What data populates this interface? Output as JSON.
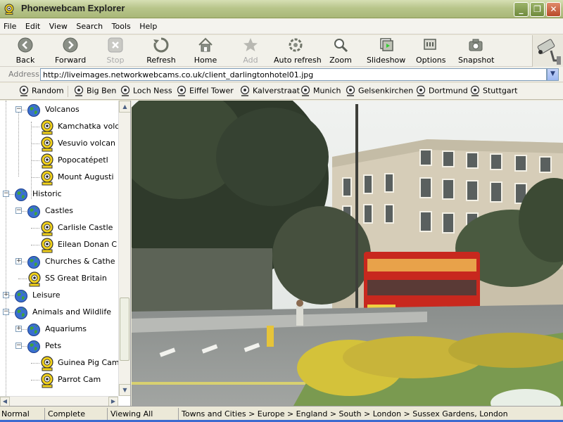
{
  "window": {
    "title": "Phonewebcam Explorer"
  },
  "menu": [
    "File",
    "Edit",
    "View",
    "Search",
    "Tools",
    "Help"
  ],
  "toolbar": [
    {
      "label": "Back",
      "icon": "back-arrow-icon",
      "enabled": true
    },
    {
      "label": "Forward",
      "icon": "forward-arrow-icon",
      "enabled": true
    },
    {
      "label": "Stop",
      "icon": "stop-icon",
      "enabled": false
    },
    {
      "label": "Refresh",
      "icon": "refresh-icon",
      "enabled": true
    },
    {
      "label": "Home",
      "icon": "home-icon",
      "enabled": true
    },
    {
      "label": "Add",
      "icon": "star-icon",
      "enabled": false
    },
    {
      "label": "Auto refresh",
      "icon": "auto-refresh-icon",
      "enabled": true
    },
    {
      "label": "Zoom",
      "icon": "magnifier-icon",
      "enabled": true
    },
    {
      "label": "Slideshow",
      "icon": "slideshow-icon",
      "enabled": true
    },
    {
      "label": "Options",
      "icon": "options-icon",
      "enabled": true
    },
    {
      "label": "Snapshot",
      "icon": "camera-icon",
      "enabled": true
    }
  ],
  "address": {
    "label": "Address",
    "value": "http://liveimages.networkwebcams.co.uk/client_darlingtonhotel01.jpg"
  },
  "links": [
    "Random",
    "Big Ben",
    "Loch Ness",
    "Eiffel Tower",
    "Kalverstraat",
    "Munich",
    "Gelsenkirchen",
    "Dortmund",
    "Stuttgart"
  ],
  "tree": {
    "nodes": [
      {
        "label": "Volcanos",
        "type": "globe",
        "expander": "−"
      },
      {
        "label": "Kamchatka volc",
        "type": "cam"
      },
      {
        "label": "Vesuvio volcan",
        "type": "cam"
      },
      {
        "label": "Popocatépetl",
        "type": "cam"
      },
      {
        "label": "Mount Augusti",
        "type": "cam"
      },
      {
        "label": "Historic",
        "type": "globe",
        "expander": "−"
      },
      {
        "label": "Castles",
        "type": "globe",
        "expander": "−"
      },
      {
        "label": "Carlisle Castle",
        "type": "cam"
      },
      {
        "label": "Eilean Donan C",
        "type": "cam"
      },
      {
        "label": "Churches & Cathe",
        "type": "globe",
        "expander": "+"
      },
      {
        "label": "SS Great Britain",
        "type": "cam"
      },
      {
        "label": "Leisure",
        "type": "globe",
        "expander": "+"
      },
      {
        "label": "Animals and Wildlife",
        "type": "globe",
        "expander": "−"
      },
      {
        "label": "Aquariums",
        "type": "globe",
        "expander": "+"
      },
      {
        "label": "Pets",
        "type": "globe",
        "expander": "−"
      },
      {
        "label": "Guinea Pig Cam",
        "type": "cam"
      },
      {
        "label": "Parrot Cam",
        "type": "cam"
      }
    ]
  },
  "status": {
    "mode": "Normal",
    "load": "Complete",
    "viewing": "Viewing All",
    "path": "Towns and Cities > Europe > England > South > London >  Sussex Gardens, London"
  },
  "colors": {
    "titlebar": "#b8c58b",
    "webcam_sky": "#e9ecec",
    "bus_red": "#c8281e",
    "hedge_yellow": "#d4c23a"
  }
}
